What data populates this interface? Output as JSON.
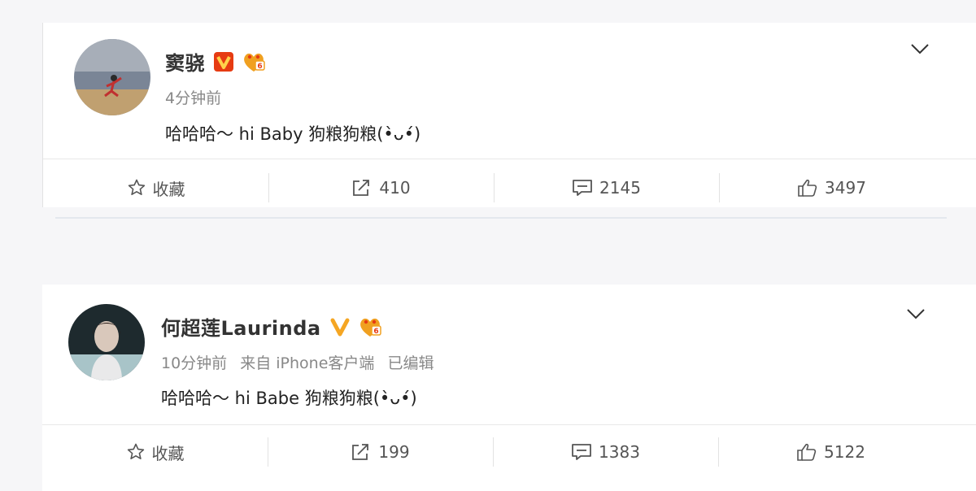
{
  "posts": [
    {
      "username": "窦骁",
      "time": "4分钟前",
      "source": "",
      "edited": "",
      "text": "哈哈哈～ hi Baby 狗粮狗粮(•̀ᴗ•́)",
      "actions": {
        "favorite": "收藏",
        "repost": "410",
        "comment": "2145",
        "like": "3497"
      }
    },
    {
      "username": "何超莲Laurinda",
      "time": "10分钟前",
      "source": "来自 iPhone客户端",
      "edited": "已编辑",
      "text": "哈哈哈～ hi Babe 狗粮狗粮(•̀ᴗ•́)",
      "actions": {
        "favorite": "收藏",
        "repost": "199",
        "comment": "1383",
        "like": "5122"
      }
    }
  ],
  "colors": {
    "verified_red": "#e63b12",
    "verified_gold": "#f5a623",
    "vip_badge": "#f0a020",
    "text_primary": "#222222",
    "text_secondary": "#888888",
    "page_bg": "#f6f6f8"
  },
  "icons": [
    "verified-v-icon",
    "vip-badge-icon",
    "chevron-down-icon",
    "star-icon",
    "repost-icon",
    "comment-icon",
    "like-icon"
  ]
}
